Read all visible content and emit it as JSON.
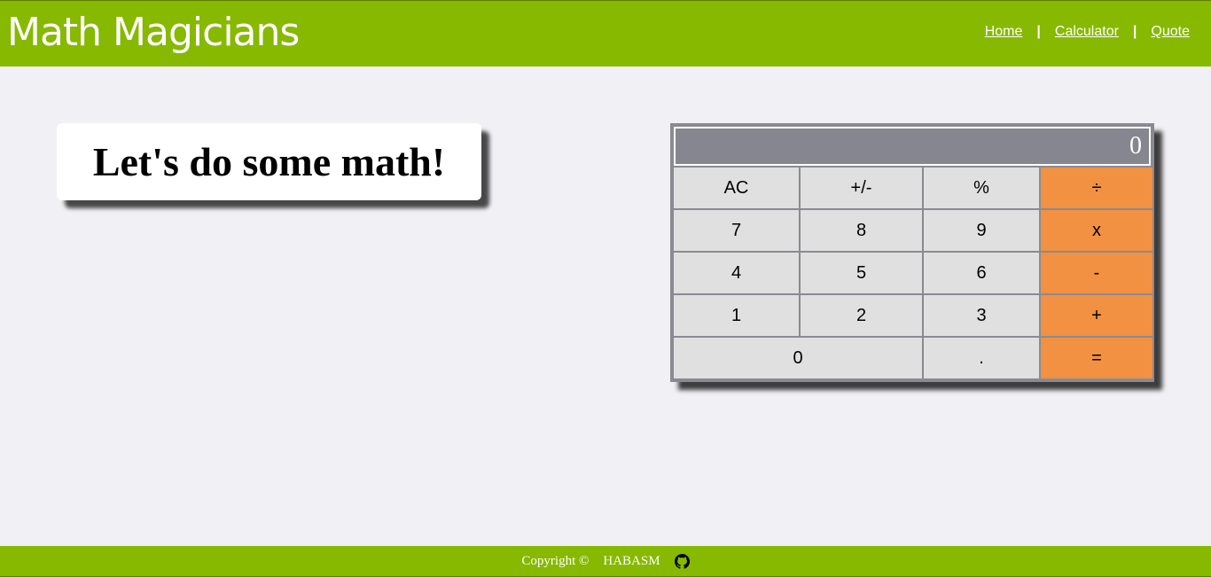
{
  "header": {
    "brand": "Math Magicians",
    "nav": [
      {
        "label": "Home"
      },
      {
        "label": "Calculator"
      },
      {
        "label": "Quote"
      }
    ],
    "separator": "|"
  },
  "main": {
    "heading": "Let's do some math!"
  },
  "calculator": {
    "display": "0",
    "keys": {
      "ac": "AC",
      "sign": "+/-",
      "percent": "%",
      "divide": "÷",
      "seven": "7",
      "eight": "8",
      "nine": "9",
      "multiply": "x",
      "four": "4",
      "five": "5",
      "six": "6",
      "minus": "-",
      "one": "1",
      "two": "2",
      "three": "3",
      "plus": "+",
      "zero": "0",
      "dot": ".",
      "equals": "="
    },
    "colors": {
      "operator": "#f29141",
      "key": "#e0e0e0",
      "display": "#85868f"
    }
  },
  "footer": {
    "copyright": "Copyright ©",
    "author": "HABASM",
    "icon": "github-icon"
  },
  "colors": {
    "brand": "#86b900",
    "background": "#f1f0f5"
  }
}
